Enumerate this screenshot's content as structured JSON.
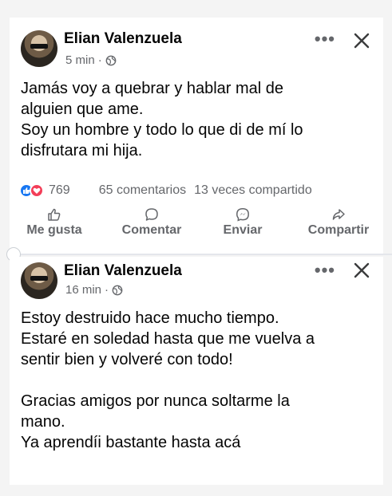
{
  "posts": [
    {
      "author": "Elian Valenzuela",
      "time": "5 min",
      "separator": "·",
      "text": [
        "Jamás voy a quebrar y hablar mal de",
        "alguien que ame.",
        "Soy un hombre y todo lo que di de mí lo",
        "disfrutara mi hija."
      ],
      "reactions_count": "769",
      "comments": "65 comentarios",
      "shares": "13 veces compartido",
      "actions": {
        "like": "Me gusta",
        "comment": "Comentar",
        "send": "Enviar",
        "share": "Compartir"
      },
      "more_symbol": "•••"
    },
    {
      "author": "Elian Valenzuela",
      "time": "16 min",
      "separator": "·",
      "text_block_1": [
        "Estoy destruido hace mucho tiempo.",
        "Estaré en soledad hasta que me vuelva a",
        "sentir bien y volveré con todo!"
      ],
      "text_block_2": [
        "Gracias amigos por nunca soltarme la",
        "mano.",
        "Ya aprendíi bastante hasta acá"
      ],
      "more_symbol": "•••"
    }
  ],
  "colors": {
    "like_blue": "#1877f2",
    "love_red": "#f33e58",
    "secondary_text": "#65676b"
  }
}
